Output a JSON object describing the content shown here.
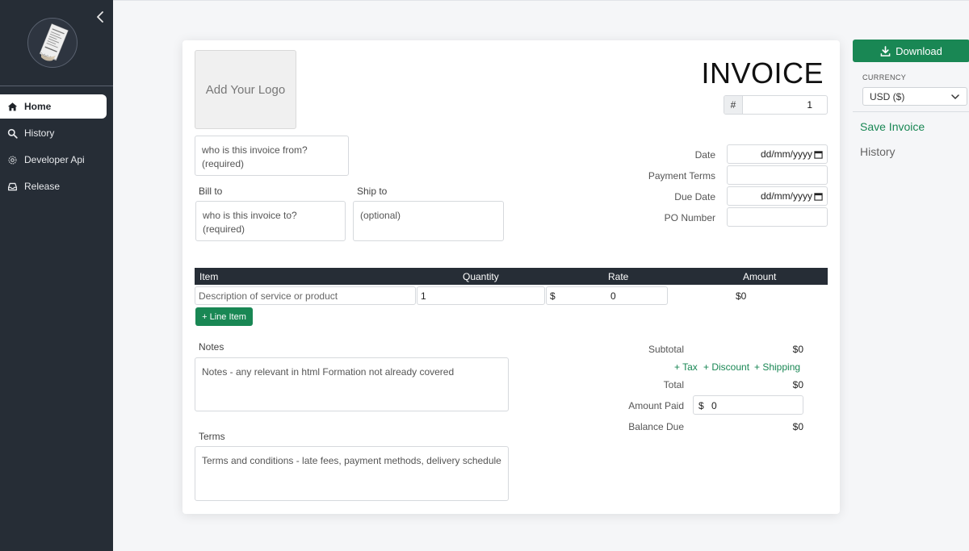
{
  "sidebar": {
    "items": [
      {
        "label": "Home",
        "icon": "home-icon",
        "active": true
      },
      {
        "label": "History",
        "icon": "search-icon"
      },
      {
        "label": "Developer Api",
        "icon": "api-icon"
      },
      {
        "label": "Release",
        "icon": "inbox-icon"
      }
    ]
  },
  "invoice": {
    "logo_placeholder": "Add Your Logo",
    "title": "INVOICE",
    "number_prefix": "#",
    "number": "1",
    "from_placeholder": "who is this invoice from? (required)",
    "bill_to_label": "Bill to",
    "bill_to_placeholder": "who is this invoice to? (required)",
    "ship_to_label": "Ship to",
    "ship_to_placeholder": "(optional)",
    "date_label": "Date",
    "date_placeholder": "dd/mm/yyyy",
    "payment_terms_label": "Payment Terms",
    "due_date_label": "Due Date",
    "due_date_placeholder": "dd/mm/yyyy",
    "po_number_label": "PO Number"
  },
  "table": {
    "headers": {
      "item": "Item",
      "quantity": "Quantity",
      "rate": "Rate",
      "amount": "Amount"
    },
    "row": {
      "description_placeholder": "Description of service or product",
      "quantity": "1",
      "currency_symbol": "$",
      "rate": "0",
      "amount": "$0"
    },
    "add_line_label": "+ Line Item"
  },
  "notes": {
    "label": "Notes",
    "placeholder": "Notes - any relevant in html Formation not already covered"
  },
  "terms": {
    "label": "Terms",
    "placeholder": "Terms and conditions - late fees, payment methods, delivery schedule"
  },
  "totals": {
    "subtotal_label": "Subtotal",
    "subtotal": "$0",
    "tax_link": "+ Tax",
    "discount_link": "+ Discount",
    "shipping_link": "+ Shipping",
    "total_label": "Total",
    "total": "$0",
    "amount_paid_label": "Amount Paid",
    "amount_paid_symbol": "$",
    "amount_paid": "0",
    "balance_due_label": "Balance Due",
    "balance_due": "$0"
  },
  "right_panel": {
    "download_label": "Download",
    "currency_label": "CURRENCY",
    "currency_value": "USD ($)",
    "save_invoice": "Save Invoice",
    "history": "History"
  },
  "colors": {
    "accent": "#198754",
    "sidebar_bg": "#262d36"
  }
}
